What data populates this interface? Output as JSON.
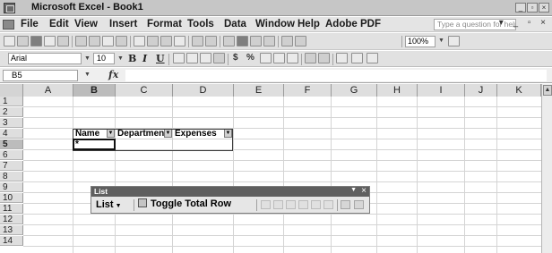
{
  "window": {
    "title": "Microsoft Excel - Book1"
  },
  "menu": {
    "items": [
      "File",
      "Edit",
      "View",
      "Insert",
      "Format",
      "Tools",
      "Data",
      "Window",
      "Help",
      "Adobe PDF"
    ],
    "help_placeholder": "Type a question for help"
  },
  "toolbar": {
    "zoom": "100%"
  },
  "format": {
    "font": "Arial",
    "size": "10",
    "bold": "B",
    "italic": "I",
    "underline": "U",
    "currency": "$",
    "percent": "%"
  },
  "formula_bar": {
    "name_box": "B5",
    "fx": "fx",
    "value": ""
  },
  "sheet": {
    "columns": [
      "A",
      "B",
      "C",
      "D",
      "E",
      "F",
      "G",
      "H",
      "I",
      "J",
      "K"
    ],
    "active_column": "B",
    "rows": [
      "1",
      "2",
      "3",
      "4",
      "5",
      "6",
      "7",
      "8",
      "9",
      "10",
      "11",
      "12",
      "13",
      "14"
    ],
    "active_row": "5"
  },
  "list": {
    "headers": [
      "Name",
      "Department",
      "Expenses"
    ],
    "new_row_marker": "*"
  },
  "list_toolbar": {
    "title": "List",
    "list_menu": "List",
    "toggle_label": "Toggle Total Row"
  }
}
